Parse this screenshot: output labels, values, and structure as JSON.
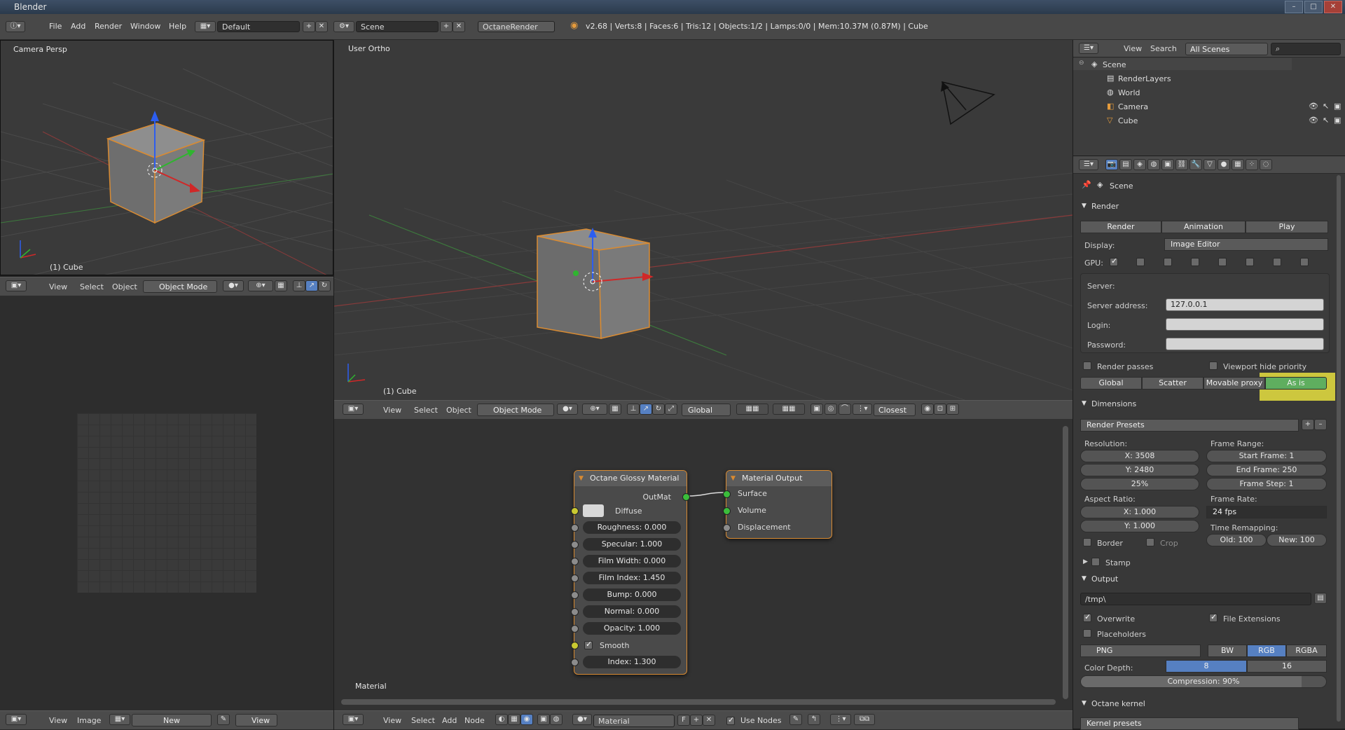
{
  "window": {
    "title": "Blender"
  },
  "top_menu": [
    "File",
    "Add",
    "Render",
    "Window",
    "Help"
  ],
  "layout_field": "Default",
  "scene_field": "Scene",
  "engine": "OctaneRender",
  "status_text": "v2.68 | Verts:8 | Faces:6 | Tris:12 | Objects:1/2 | Lamps:0/0 | Mem:10.37M (0.87M) | Cube",
  "viewport_small": {
    "label": "Camera Persp",
    "object": "(1) Cube"
  },
  "viewport_main": {
    "label": "User Ortho",
    "object": "(1) Cube"
  },
  "header_small": {
    "menus": [
      "View",
      "Select",
      "Object"
    ],
    "mode": "Object Mode"
  },
  "header_main": {
    "menus": [
      "View",
      "Select",
      "Object"
    ],
    "mode": "Object Mode",
    "orientation": "Global",
    "snap": "Closest"
  },
  "image_header": {
    "menus": [
      "View",
      "Image"
    ],
    "new": "New",
    "view": "View"
  },
  "node_editor": {
    "label": "Material",
    "header": {
      "menus": [
        "View",
        "Select",
        "Add",
        "Node"
      ],
      "material": "Material",
      "fake": "F",
      "use_nodes": "Use Nodes"
    },
    "glossy": {
      "title": "Octane Glossy Material",
      "out": "OutMat",
      "diffuse": "Diffuse",
      "fields": [
        "Roughness: 0.000",
        "Specular: 1.000",
        "Film Width: 0.000",
        "Film Index: 1.450",
        "Bump: 0.000",
        "Normal: 0.000",
        "Opacity: 1.000"
      ],
      "smooth": "Smooth",
      "index": "Index: 1.300"
    },
    "output": {
      "title": "Material Output",
      "sockets": [
        "Surface",
        "Volume",
        "Displacement"
      ]
    }
  },
  "outliner": {
    "menus": [
      "View",
      "Search"
    ],
    "scenes": "All Scenes",
    "items": [
      "Scene",
      "RenderLayers",
      "World",
      "Camera",
      "Cube"
    ]
  },
  "properties": {
    "context": "Scene",
    "render_section": "Render",
    "render_buttons": [
      "Render",
      "Animation",
      "Play"
    ],
    "display_label": "Display:",
    "display_value": "Image Editor",
    "gpu_label": "GPU:",
    "server_label": "Server:",
    "server_address_label": "Server address:",
    "server_address": "127.0.0.1",
    "login_label": "Login:",
    "password_label": "Password:",
    "render_passes": "Render passes",
    "viewport_hide": "Viewport hide priority",
    "tabs": [
      "Global",
      "Scatter",
      "Movable proxy",
      "As is"
    ],
    "dimensions": "Dimensions",
    "render_presets": "Render Presets",
    "resolution_label": "Resolution:",
    "res_x": "X: 3508",
    "res_y": "Y: 2480",
    "res_pct": "25%",
    "frame_range_label": "Frame Range:",
    "start_frame": "Start Frame: 1",
    "end_frame": "End Frame: 250",
    "frame_step": "Frame Step: 1",
    "aspect_label": "Aspect Ratio:",
    "asp_x": "X: 1.000",
    "asp_y": "Y: 1.000",
    "frame_rate_label": "Frame Rate:",
    "fps": "24 fps",
    "remap_label": "Time Remapping:",
    "old": "Old: 100",
    "new": "New: 100",
    "border": "Border",
    "crop": "Crop",
    "stamp": "Stamp",
    "output": "Output",
    "path": "/tmp\\",
    "overwrite": "Overwrite",
    "file_ext": "File Extensions",
    "placeholders": "Placeholders",
    "format": "PNG",
    "color_modes": [
      "BW",
      "RGB",
      "RGBA"
    ],
    "color_depth_label": "Color Depth:",
    "depths": [
      "8",
      "16"
    ],
    "compression": "Compression: 90%",
    "octane_kernel": "Octane kernel",
    "kernel_presets": "Kernel presets"
  },
  "colors": {
    "accent_orange": "#d98b32",
    "select_blue": "#5680c2",
    "highlight_yellow": "#e8e040"
  }
}
